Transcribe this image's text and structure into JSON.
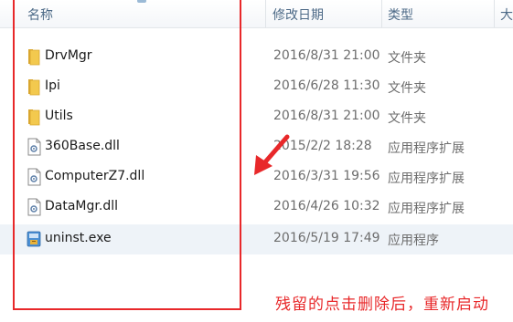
{
  "columns": {
    "name": "名称",
    "date": "修改日期",
    "type": "类型",
    "size": "大"
  },
  "files": [
    {
      "name": "DrvMgr",
      "date": "2016/8/31 21:00",
      "type": "文件夹",
      "icon": "folder-icon"
    },
    {
      "name": "Ipi",
      "date": "2016/6/28 11:30",
      "type": "文件夹",
      "icon": "folder-icon"
    },
    {
      "name": "Utils",
      "date": "2016/8/31 21:00",
      "type": "文件夹",
      "icon": "folder-icon"
    },
    {
      "name": "360Base.dll",
      "date": "2015/2/2 18:28",
      "type": "应用程序扩展",
      "icon": "dll-file-icon"
    },
    {
      "name": "ComputerZ7.dll",
      "date": "2016/3/31 19:56",
      "type": "应用程序扩展",
      "icon": "dll-file-icon"
    },
    {
      "name": "DataMgr.dll",
      "date": "2016/4/26 10:32",
      "type": "应用程序扩展",
      "icon": "dll-file-icon"
    },
    {
      "name": "uninst.exe",
      "date": "2016/5/19 17:49",
      "type": "应用程序",
      "icon": "exe-file-icon"
    }
  ],
  "annotation": "残留的点击删除后，重新启动",
  "colors": {
    "annotation_red": "#e8282a",
    "folder_yellow": "#f3c94e",
    "header_text": "#4d6a87"
  }
}
